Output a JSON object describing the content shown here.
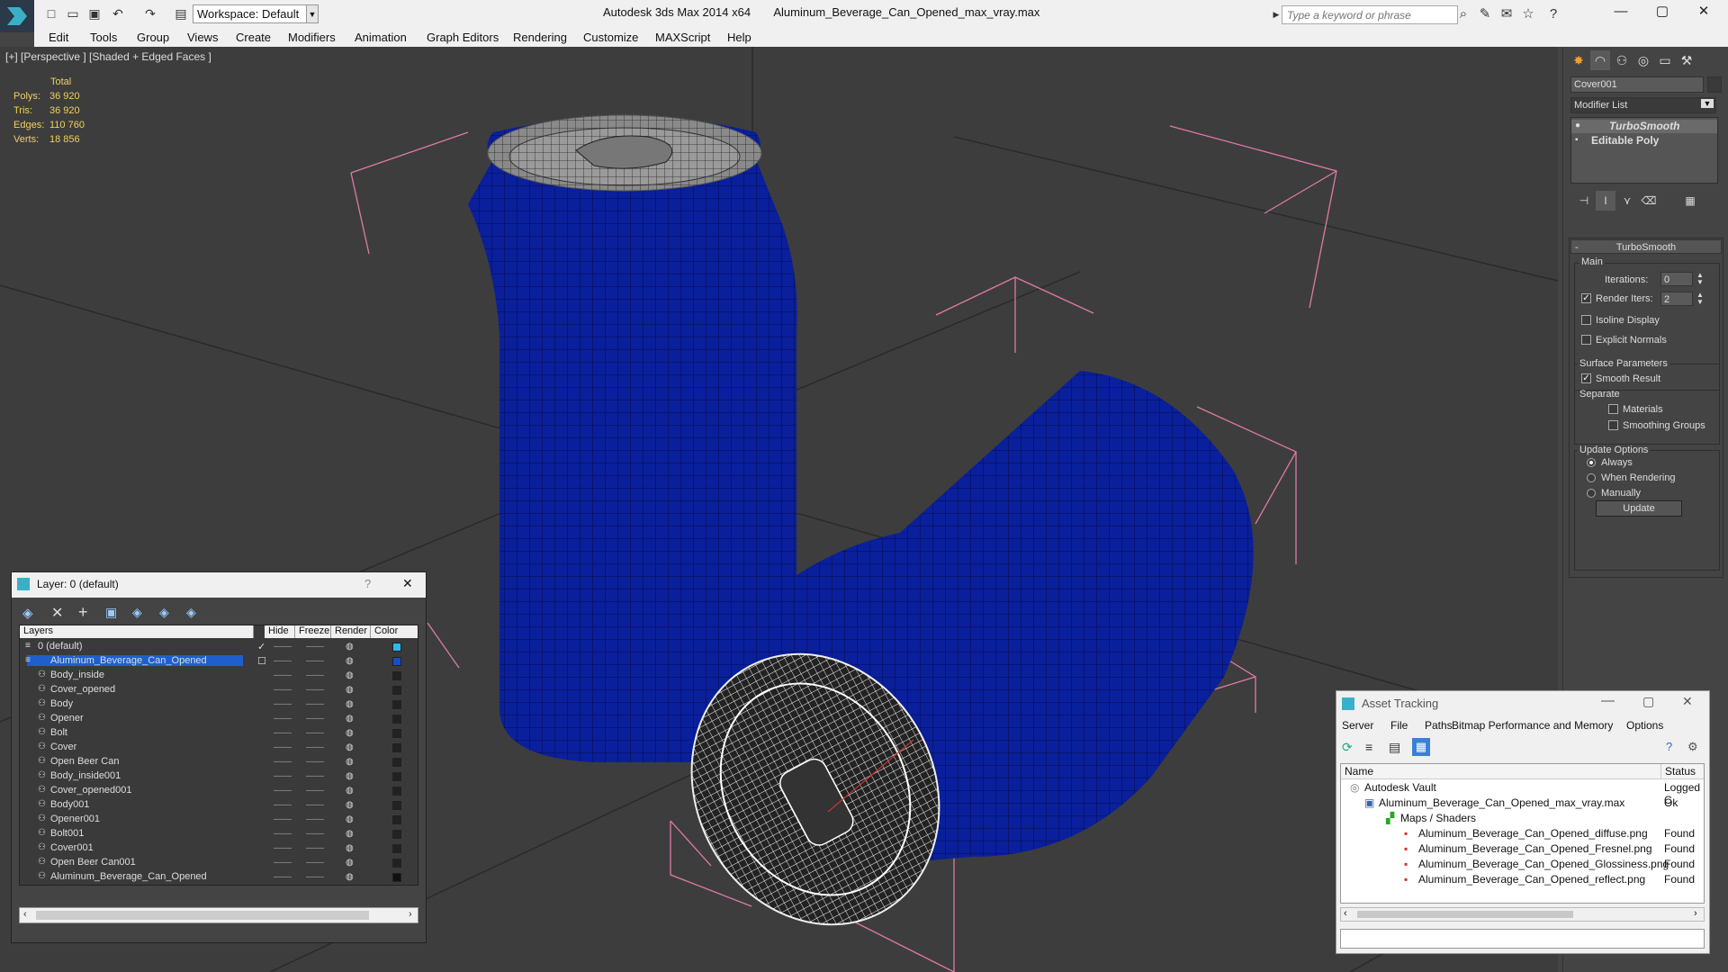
{
  "titlebar": {
    "app_title": "Autodesk 3ds Max 2014 x64",
    "file_name": "Aluminum_Beverage_Can_Opened_max_vray.max",
    "workspace_label": "Workspace: Default",
    "search_placeholder": "Type a keyword or phrase"
  },
  "menu": [
    "Edit",
    "Tools",
    "Group",
    "Views",
    "Create",
    "Modifiers",
    "Animation",
    "Graph Editors",
    "Rendering",
    "Customize",
    "MAXScript",
    "Help"
  ],
  "viewport": {
    "label": "[+] [Perspective ] [Shaded + Edged Faces ]",
    "stats_header": "Total",
    "stats": [
      {
        "label": "Polys:",
        "value": "36 920"
      },
      {
        "label": "Tris:",
        "value": "36 920"
      },
      {
        "label": "Edges:",
        "value": "110 760"
      },
      {
        "label": "Verts:",
        "value": "18 856"
      }
    ]
  },
  "command_panel": {
    "object_name": "Cover001",
    "modifier_list": "Modifier List",
    "stack": [
      "TurboSmooth",
      "Editable Poly"
    ],
    "rollout_title": "TurboSmooth",
    "main_group": "Main",
    "iterations_label": "Iterations:",
    "iterations_value": "0",
    "render_iters_label": "Render Iters:",
    "render_iters_value": "2",
    "isoline": "Isoline Display",
    "explicit_normals": "Explicit Normals",
    "surface_params": "Surface Parameters",
    "smooth_result": "Smooth Result",
    "separate": "Separate",
    "materials": "Materials",
    "smoothing_groups": "Smoothing Groups",
    "update_options": "Update Options",
    "always": "Always",
    "when_rendering": "When Rendering",
    "manually": "Manually",
    "update_button": "Update"
  },
  "layer_dialog": {
    "title": "Layer: 0 (default)",
    "help": "?",
    "columns": [
      "Layers",
      "Hide",
      "Freeze",
      "Render",
      "Color"
    ],
    "rows": [
      {
        "name": "0 (default)",
        "color": "#2fb8e8"
      },
      {
        "name": "Aluminum_Beverage_Can_Opened",
        "color": "#1050c8"
      },
      {
        "name": "Body_inside",
        "color": "#222222"
      },
      {
        "name": "Cover_opened",
        "color": "#222222"
      },
      {
        "name": "Body",
        "color": "#222222"
      },
      {
        "name": "Opener",
        "color": "#222222"
      },
      {
        "name": "Bolt",
        "color": "#222222"
      },
      {
        "name": "Cover",
        "color": "#222222"
      },
      {
        "name": "Open Beer Can",
        "color": "#222222"
      },
      {
        "name": "Body_inside001",
        "color": "#222222"
      },
      {
        "name": "Cover_opened001",
        "color": "#222222"
      },
      {
        "name": "Body001",
        "color": "#222222"
      },
      {
        "name": "Opener001",
        "color": "#222222"
      },
      {
        "name": "Bolt001",
        "color": "#222222"
      },
      {
        "name": "Cover001",
        "color": "#222222"
      },
      {
        "name": "Open Beer Can001",
        "color": "#222222"
      },
      {
        "name": "Aluminum_Beverage_Can_Opened",
        "color": "#111111"
      }
    ]
  },
  "asset_tracking": {
    "title": "Asset Tracking",
    "menu": [
      "Server",
      "File",
      "Paths",
      "Bitmap Performance and Memory",
      "Options"
    ],
    "columns": [
      "Name",
      "Status"
    ],
    "rows": [
      {
        "name": "Autodesk Vault",
        "status": "Logged C"
      },
      {
        "name": "Aluminum_Beverage_Can_Opened_max_vray.max",
        "status": "Ok"
      },
      {
        "name": "Maps / Shaders",
        "status": ""
      },
      {
        "name": "Aluminum_Beverage_Can_Opened_diffuse.png",
        "status": "Found"
      },
      {
        "name": "Aluminum_Beverage_Can_Opened_Fresnel.png",
        "status": "Found"
      },
      {
        "name": "Aluminum_Beverage_Can_Opened_Glossiness.png",
        "status": "Found"
      },
      {
        "name": "Aluminum_Beverage_Can_Opened_reflect.png",
        "status": "Found"
      }
    ]
  },
  "colors": {
    "can_blue": "#0a1f9c",
    "bbox_pink": "#e07aa8",
    "stats_yellow": "#f0d060",
    "selection_blue": "#1e5fd0"
  }
}
